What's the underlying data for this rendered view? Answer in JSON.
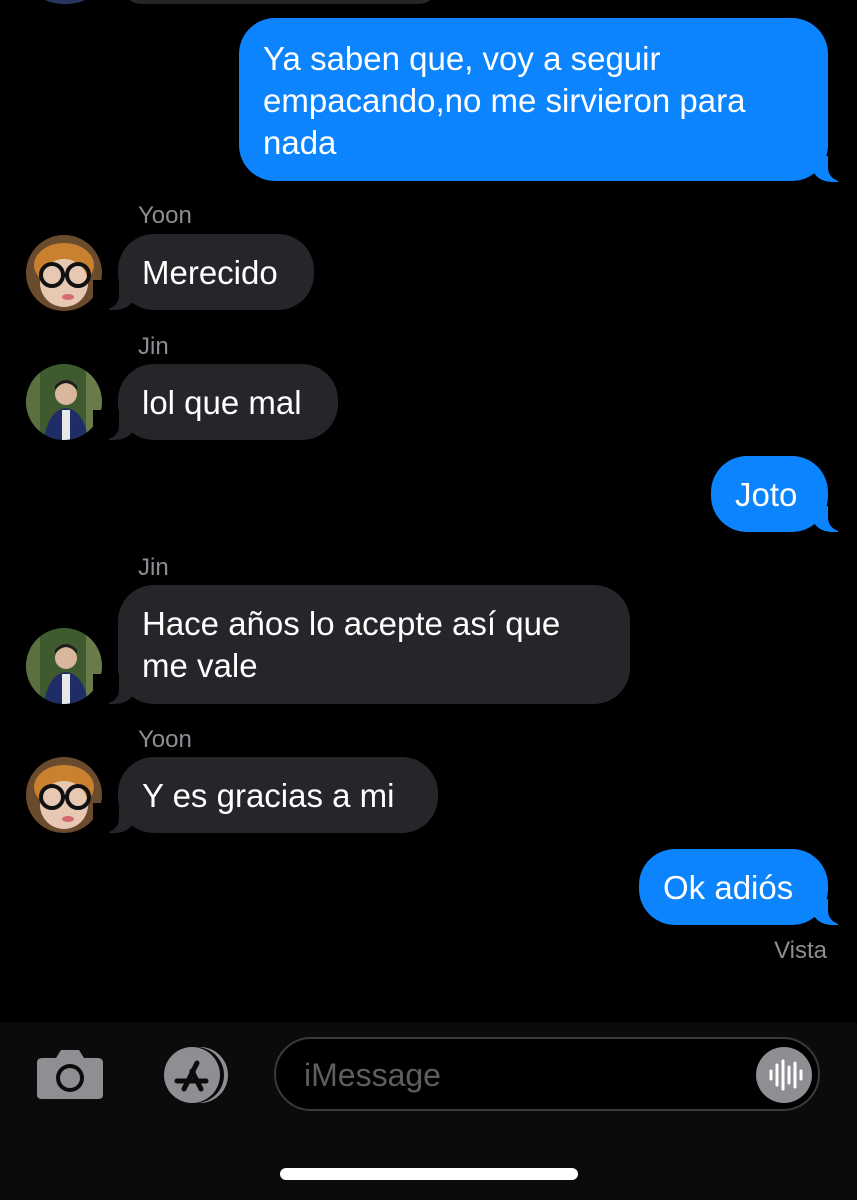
{
  "thread": {
    "messages": [
      {
        "id": "m1",
        "direction": "outgoing",
        "text": "Ya saben que, voy a seguir\nempacando,no me sirvieron para\nnada"
      },
      {
        "id": "m2",
        "direction": "incoming",
        "sender": "Yoon",
        "text": "Merecido"
      },
      {
        "id": "m3",
        "direction": "incoming",
        "sender": "Jin",
        "text": "lol que mal"
      },
      {
        "id": "m4",
        "direction": "outgoing",
        "text": "Joto"
      },
      {
        "id": "m5",
        "direction": "incoming",
        "sender": "Jin",
        "text": "Hace años lo acepte así que\nme vale"
      },
      {
        "id": "m6",
        "direction": "incoming",
        "sender": "Yoon",
        "text": "Y es gracias a mi"
      },
      {
        "id": "m7",
        "direction": "outgoing",
        "text": "Ok adiós"
      }
    ],
    "read_status": "Vista"
  },
  "composer": {
    "placeholder": "iMessage",
    "camera_icon": "camera-icon",
    "apps_icon": "app-store-icon",
    "audio_icon": "audio-waveform-icon"
  },
  "colors": {
    "outgoing_bubble": "#0b84fe",
    "incoming_bubble": "#26252a",
    "background": "#000000",
    "secondary_text": "#8d8d93"
  }
}
